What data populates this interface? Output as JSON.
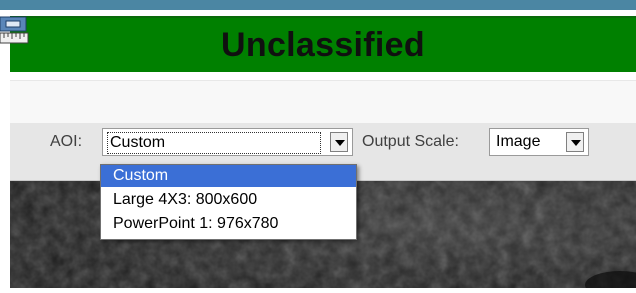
{
  "banner": {
    "title": "Unclassified",
    "color": "#008000"
  },
  "toolbar": {
    "tool_icon": "measure-ruler-icon",
    "aoi_label": "AOI:",
    "aoi_value": "Custom",
    "output_scale_label": "Output Scale:",
    "output_scale_value": "Image"
  },
  "aoi_dropdown": {
    "options": [
      "Custom",
      "Large 4X3: 800x600",
      "PowerPoint 1: 976x780"
    ],
    "selected": "Custom",
    "highlight_color": "#3b6fd6"
  }
}
